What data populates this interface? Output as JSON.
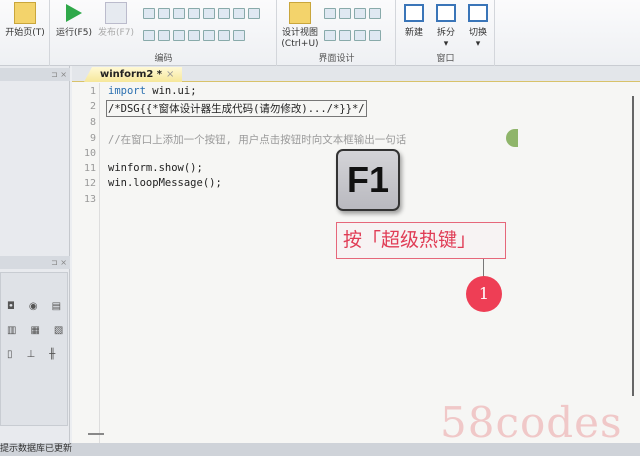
{
  "ribbon": {
    "start_page": "开始页(T)",
    "run": "运行(F5)",
    "publish": "发布(F7)",
    "group_code": "编码",
    "design_view": "设计视图",
    "design_view_shortcut": "(Ctrl+U)",
    "group_ui_design": "界面设计",
    "new": "新建",
    "split": "拆分",
    "switch": "切换",
    "group_window": "窗口"
  },
  "editor": {
    "tab_label": "winform2 *",
    "tab_close": "×",
    "lines": [
      {
        "num": "1",
        "text": "win.ui;",
        "keyword": "import "
      },
      {
        "num": "2",
        "text": "/*DSG{{*窗体设计器生成代码(请勿修改).../*}}*/"
      },
      {
        "num": "8",
        "text": ""
      },
      {
        "num": "9",
        "text": "//在窗口上添加一个按钮, 用户点击按钮时向文本框输出一句话"
      },
      {
        "num": "10",
        "text": ""
      },
      {
        "num": "11",
        "text": "winform.show();"
      },
      {
        "num": "12",
        "text": "win.loopMessage();"
      },
      {
        "num": "13",
        "text": ""
      }
    ]
  },
  "overlay": {
    "key": "F1",
    "hint": "按「超级热键」",
    "step": "1",
    "watermark": "58codes"
  },
  "status": {
    "text": "提示数据库已更新"
  }
}
